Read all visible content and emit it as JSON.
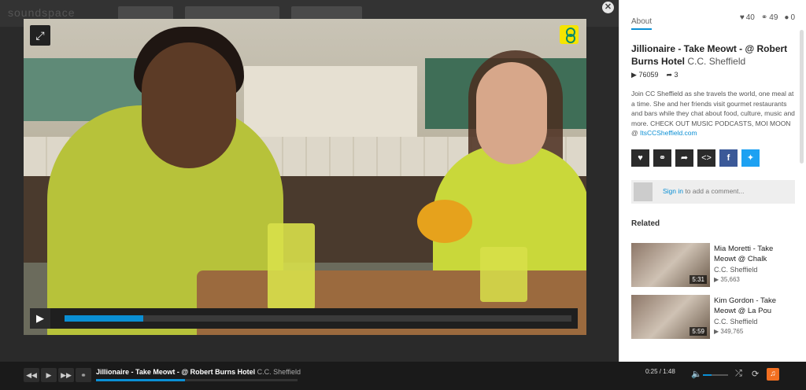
{
  "background": {
    "logo": "soundspace"
  },
  "player": {
    "fullscreen_icon": "expand-arrows-icon",
    "brand_badge": "brand-logo-icon",
    "play_icon": "play-icon",
    "progress_fraction": 0.156,
    "close_icon": "close-icon"
  },
  "about": {
    "tab_label": "About",
    "likes": "40",
    "reposts": "49",
    "comments": "0",
    "title": "Jillionaire - Take Meowt - @ Robert Burns Hotel",
    "owner": "C.C. Sheffield",
    "plays": "76059",
    "shares": "3",
    "description": "Join CC Sheffield as she travels the world, one meal at a time. She and her friends visit gourmet restaurants and bars while they chat about food, culture, music and more. CHECK OUT MUSIC PODCASTS, MOI MOON @ ",
    "description_link": "ItsCCSheffield.com"
  },
  "comment_box": {
    "sign_in": "Sign in",
    "rest": " to add a comment..."
  },
  "related": {
    "heading": "Related",
    "items": [
      {
        "title": "Mia Moretti - Take Meowt @ Chalk",
        "owner": "C.C. Sheffield",
        "views": "35,663",
        "duration": "5:31"
      },
      {
        "title": "Kim Gordon - Take Meowt @ La Pou",
        "owner": "C.C. Sheffield",
        "views": "349,765",
        "duration": "5:59"
      }
    ]
  },
  "bottom": {
    "title": "Jillionaire - Take Meowt - @ Robert Burns Hotel",
    "owner": "C.C. Sheffield",
    "time": "0:25 / 1:48",
    "progress_fraction": 0.44,
    "volume_fraction": 0.35
  }
}
